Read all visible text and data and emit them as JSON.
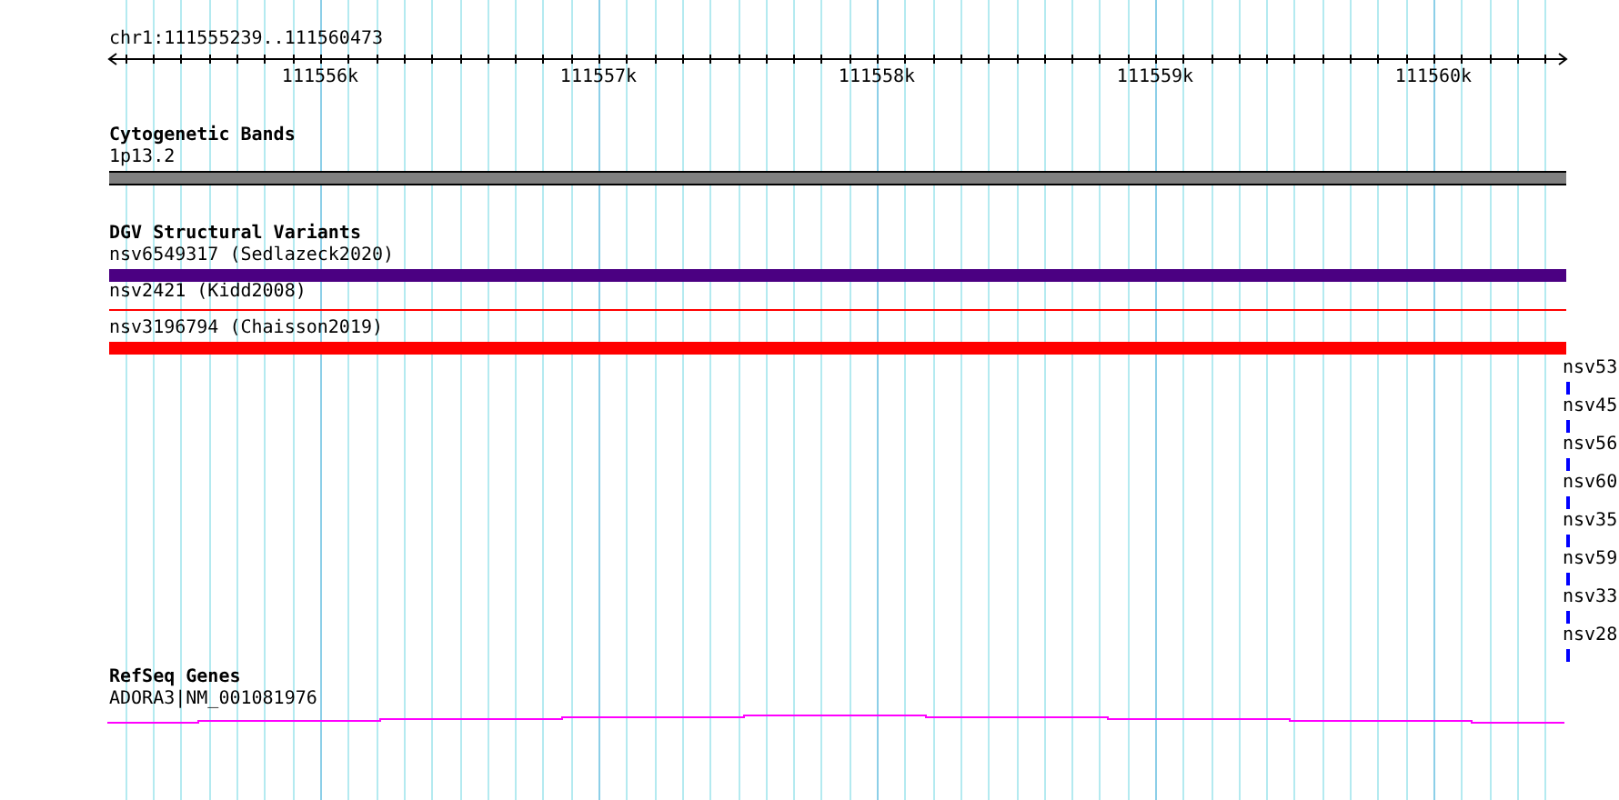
{
  "location": "chr1:111555239..111560473",
  "ruler": {
    "ticks": [
      "111556k",
      "111557k",
      "111558k",
      "111559k",
      "111560k"
    ]
  },
  "bands": {
    "title": "Cytogenetic Bands",
    "features": [
      {
        "label": "1p13.2",
        "kind": "band"
      }
    ]
  },
  "variants": {
    "title": "DGV Structural Variants",
    "features": [
      {
        "label": "nsv6549317 (Sedlazeck2020)",
        "kind": "bar",
        "color": "#4b0082"
      },
      {
        "label": "nsv2421 (Kidd2008)",
        "kind": "line",
        "color": "#ff0000"
      },
      {
        "label": "nsv3196794 (Chaisson2019)",
        "kind": "bar",
        "color": "#ff0000"
      }
    ],
    "side_labels": [
      "nsv53",
      "nsv45",
      "nsv56",
      "nsv60",
      "nsv35",
      "nsv59",
      "nsv33",
      "nsv28"
    ]
  },
  "genes": {
    "title": "RefSeq Genes",
    "features": [
      {
        "label": "ADORA3|NM_001081976",
        "kind": "gene"
      }
    ]
  }
}
